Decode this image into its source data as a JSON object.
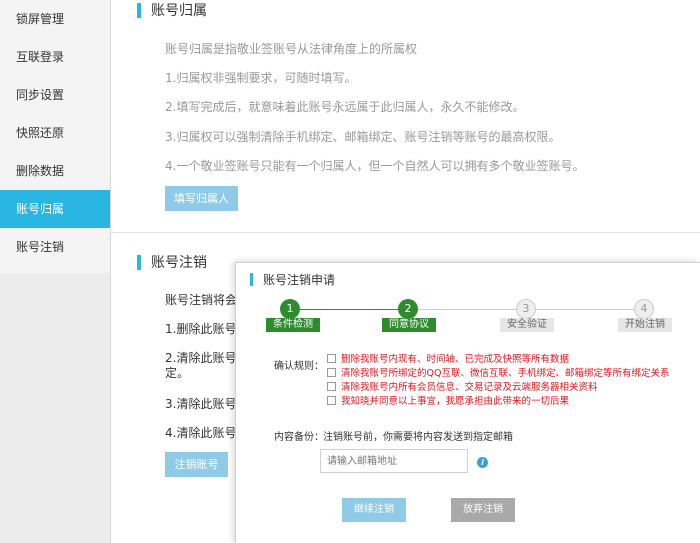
{
  "sidebar": {
    "items": [
      {
        "label": "锁屏管理"
      },
      {
        "label": "互联登录"
      },
      {
        "label": "同步设置"
      },
      {
        "label": "快照还原"
      },
      {
        "label": "删除数据"
      },
      {
        "label": "账号归属"
      },
      {
        "label": "账号注销"
      }
    ],
    "active_index": 5
  },
  "ownership": {
    "title": "账号归属",
    "intro": "账号归属是指敬业签账号从法律角度上的所属权",
    "points": [
      "1.归属权非强制要求，可随时填写。",
      "2.填写完成后，就意味着此账号永远属于此归属人，永久不能修改。",
      "3.归属权可以强制清除手机绑定、邮箱绑定、账号注销等账号的最高权限。",
      "4.一个敬业签账号只能有一个归属人，但一个自然人可以拥有多个敬业签账号。"
    ],
    "fill_button": "填写归属人"
  },
  "cancellation": {
    "title": "账号注销",
    "intro": "账号注销将会",
    "points": [
      "1.删除此账号",
      "2.清除此账号",
      "定。",
      "3.清除此账号",
      "4.清除此账号"
    ],
    "cancel_button": "注销账号"
  },
  "modal": {
    "title": "账号注销申请",
    "steps": [
      {
        "num": "1",
        "label": "条件检测",
        "state": "done"
      },
      {
        "num": "2",
        "label": "同意协议",
        "state": "done"
      },
      {
        "num": "3",
        "label": "安全验证",
        "state": "todo"
      },
      {
        "num": "4",
        "label": "开始注销",
        "state": "todo"
      }
    ],
    "rules_label": "确认规则：",
    "rules": [
      "删除我账号内现有、时间轴、已完成及快照等所有数据",
      "清除我账号所绑定的QQ互联、微信互联、手机绑定、邮箱绑定等所有绑定关系",
      "清除我账号内所有会员信息、交易记录及云端服务器相关资料",
      "我知晓并同意以上事宜，我愿承担由此带来的一切后果"
    ],
    "backup_label": "内容备份：",
    "backup_text": "注销账号前，你需要将内容发送到指定邮箱",
    "email_placeholder": "请输入邮箱地址",
    "info_icon": "i",
    "continue_button": "继续注销",
    "abandon_button": "放弃注销"
  },
  "colors": {
    "accent": "#29b6e0",
    "step_done": "#2e8b2e",
    "rule_text": "#e8141a",
    "button_blue": "#8fcbe6",
    "button_gray": "#a9a9a9"
  }
}
